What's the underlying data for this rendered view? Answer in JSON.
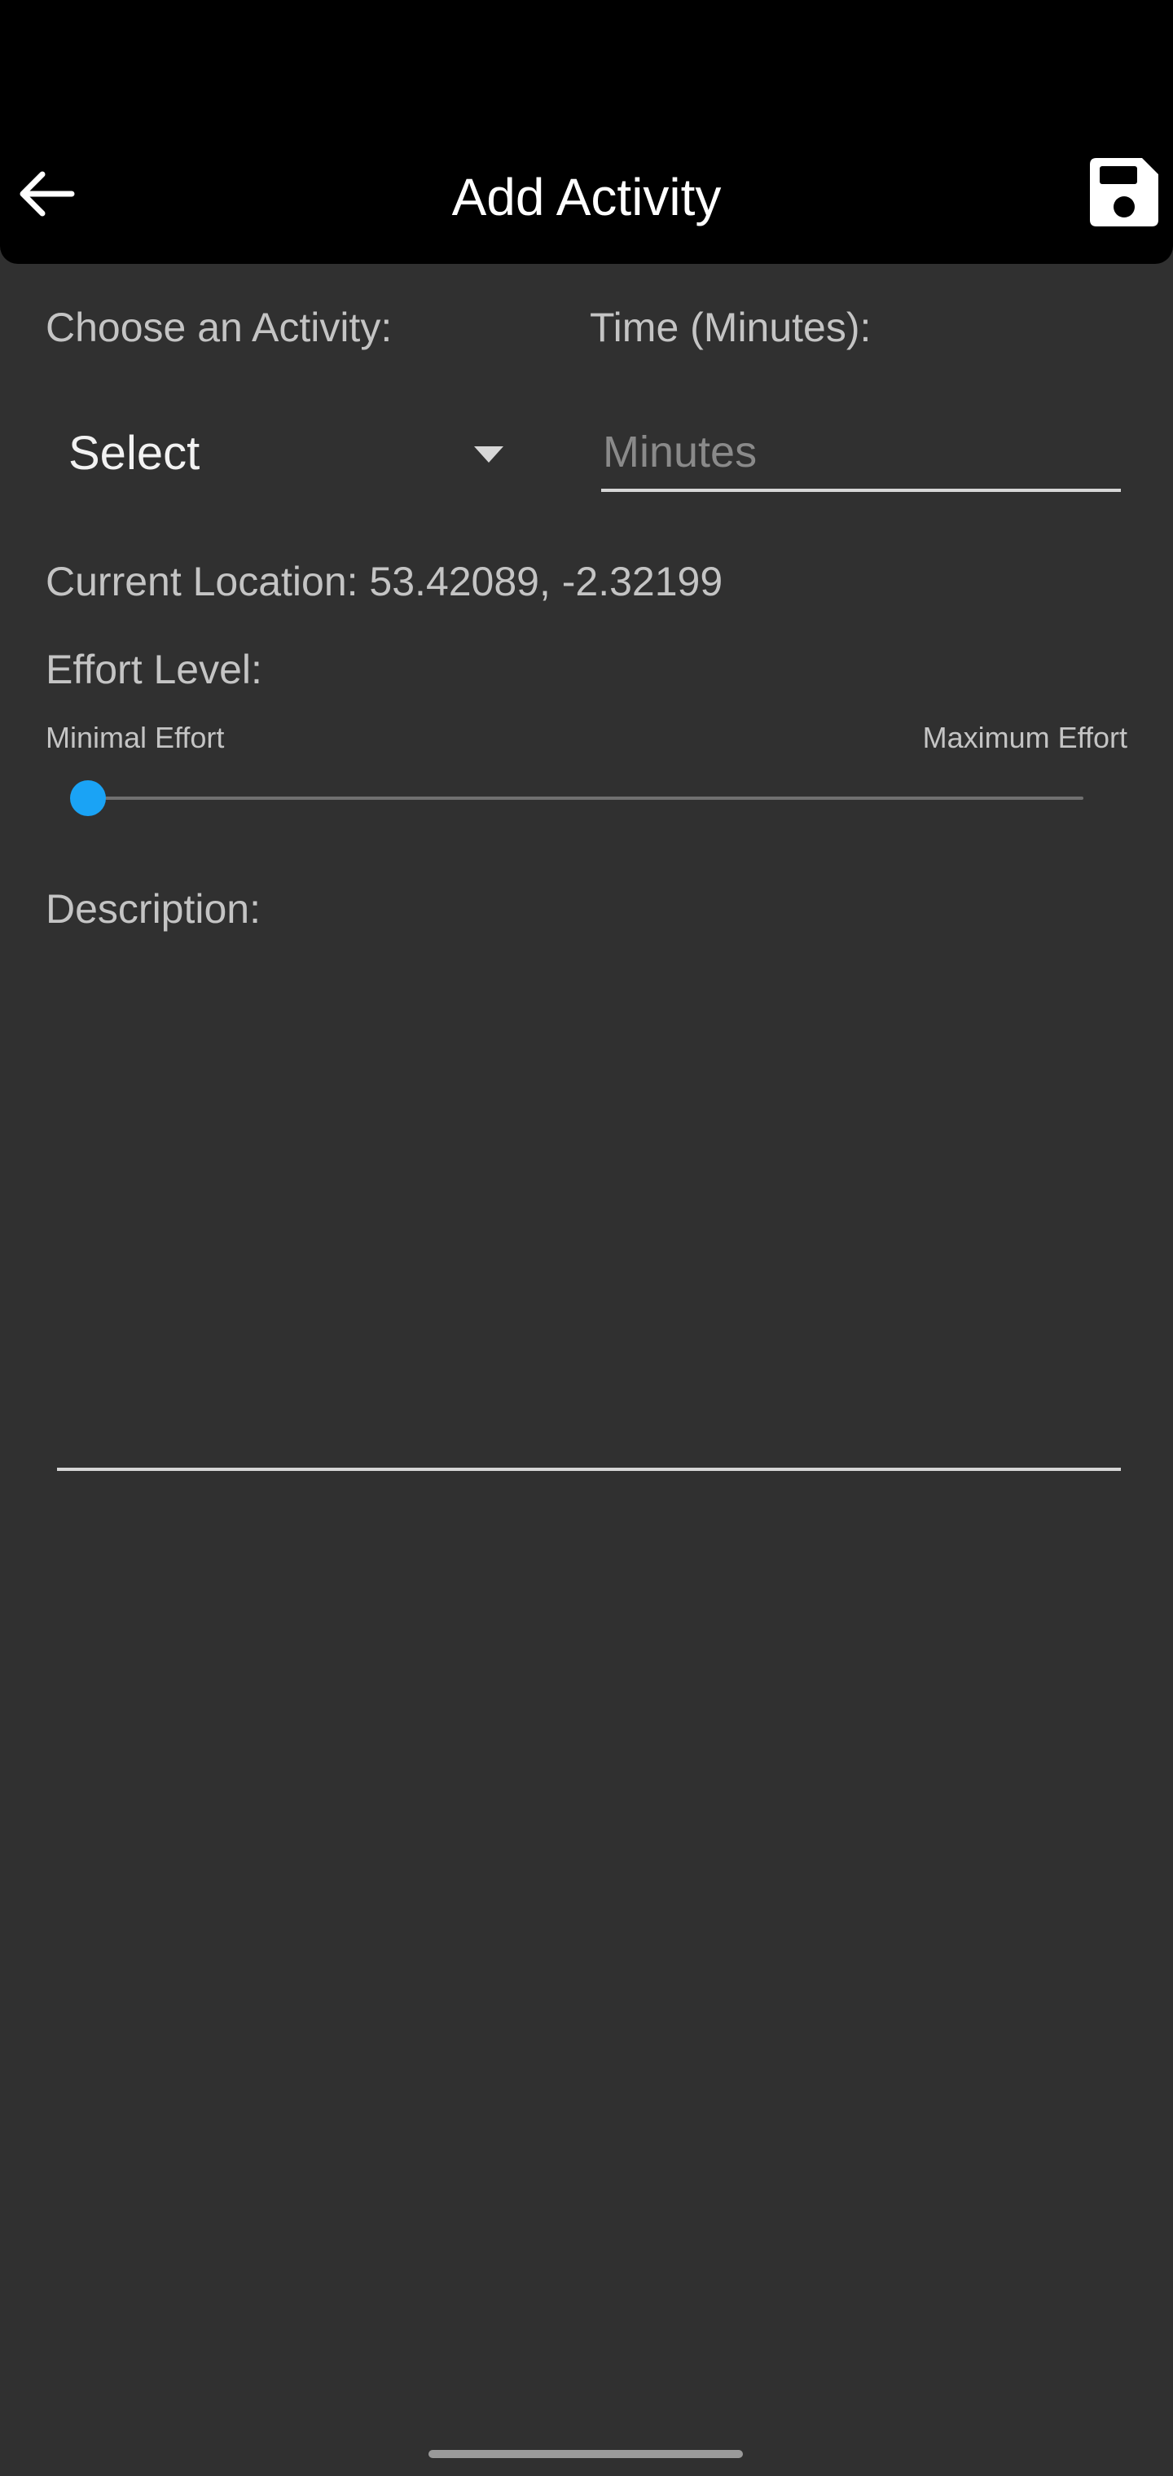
{
  "app_bar": {
    "title": "Add Activity",
    "back_icon": "arrow-back-icon",
    "save_icon": "floppy-disk-icon"
  },
  "form": {
    "activity_label": "Choose an Activity:",
    "activity_spinner": {
      "selected": "Select",
      "icon": "dropdown-triangle-icon"
    },
    "time_label": "Time (Minutes):",
    "time_input": {
      "value": "",
      "placeholder": "Minutes"
    },
    "location_text": "Current Location: 53.42089, -2.32199",
    "effort_label": "Effort Level:",
    "effort_min_label": "Minimal Effort",
    "effort_max_label": "Maximum Effort",
    "effort_level": 0,
    "description_label": "Description:",
    "description_value": ""
  },
  "colors": {
    "background": "#303030",
    "app_bar": "#000000",
    "accent": "#1aa3f5",
    "label_text": "#c4c4c4"
  }
}
